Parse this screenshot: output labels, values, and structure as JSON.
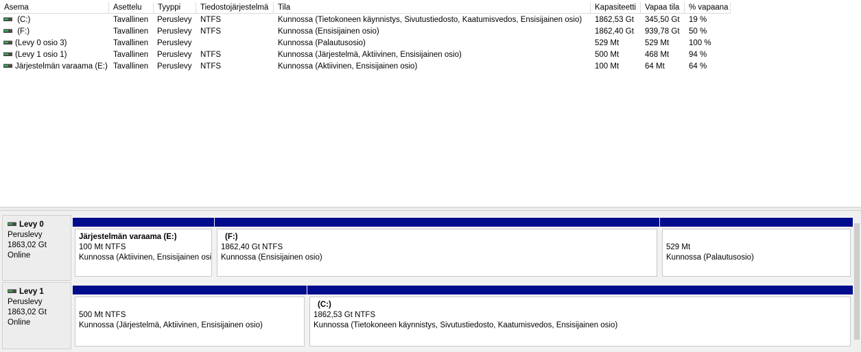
{
  "columns": [
    "Asema",
    "Asettelu",
    "Tyyppi",
    "Tiedostojärjestelmä",
    "Tila",
    "Kapasiteetti",
    "Vapaa tila",
    "% vapaana"
  ],
  "volumes": [
    {
      "name": " (C:)",
      "layout": "Tavallinen",
      "type": "Peruslevy",
      "fs": "NTFS",
      "status": "Kunnossa (Tietokoneen käynnistys, Sivutustiedosto, Kaatumisvedos, Ensisijainen osio)",
      "capacity": "1862,53 Gt",
      "free": "345,50 Gt",
      "pct": "19 %"
    },
    {
      "name": " (F:)",
      "layout": "Tavallinen",
      "type": "Peruslevy",
      "fs": "NTFS",
      "status": "Kunnossa (Ensisijainen osio)",
      "capacity": "1862,40 Gt",
      "free": "939,78 Gt",
      "pct": "50 %"
    },
    {
      "name": "(Levy 0 osio 3)",
      "layout": "Tavallinen",
      "type": "Peruslevy",
      "fs": "",
      "status": "Kunnossa (Palautusosio)",
      "capacity": "529 Mt",
      "free": "529 Mt",
      "pct": "100 %"
    },
    {
      "name": "(Levy 1 osio 1)",
      "layout": "Tavallinen",
      "type": "Peruslevy",
      "fs": "NTFS",
      "status": "Kunnossa (Järjestelmä, Aktiivinen, Ensisijainen osio)",
      "capacity": "500 Mt",
      "free": "468 Mt",
      "pct": "94 %"
    },
    {
      "name": "Järjestelmän varaama (E:)",
      "layout": "Tavallinen",
      "type": "Peruslevy",
      "fs": "NTFS",
      "status": "Kunnossa (Aktiivinen, Ensisijainen osio)",
      "capacity": "100 Mt",
      "free": "64 Mt",
      "pct": "64 %"
    }
  ],
  "disks": [
    {
      "name": "Levy 0",
      "type": "Peruslevy",
      "size": "1863,02 Gt",
      "state": "Online",
      "partitions": [
        {
          "title": "Järjestelmän varaama  (E:)",
          "size": "100 Mt NTFS",
          "status": "Kunnossa (Aktiivinen, Ensisijainen osio)"
        },
        {
          "title": "(F:)",
          "size": "1862,40 Gt NTFS",
          "status": "Kunnossa (Ensisijainen osio)"
        },
        {
          "title": "",
          "size": "529 Mt",
          "status": "Kunnossa (Palautusosio)"
        }
      ]
    },
    {
      "name": "Levy 1",
      "type": "Peruslevy",
      "size": "1863,02 Gt",
      "state": "Online",
      "partitions": [
        {
          "title": "",
          "size": "500 Mt NTFS",
          "status": "Kunnossa (Järjestelmä, Aktiivinen, Ensisijainen osio)"
        },
        {
          "title": "(C:)",
          "size": "1862,53 Gt NTFS",
          "status": "Kunnossa (Tietokoneen käynnistys, Sivutustiedosto, Kaatumisvedos, Ensisijainen osio)"
        }
      ]
    }
  ],
  "colors": {
    "partition_bar": "#000c8c",
    "selection": "#cce8ff"
  }
}
